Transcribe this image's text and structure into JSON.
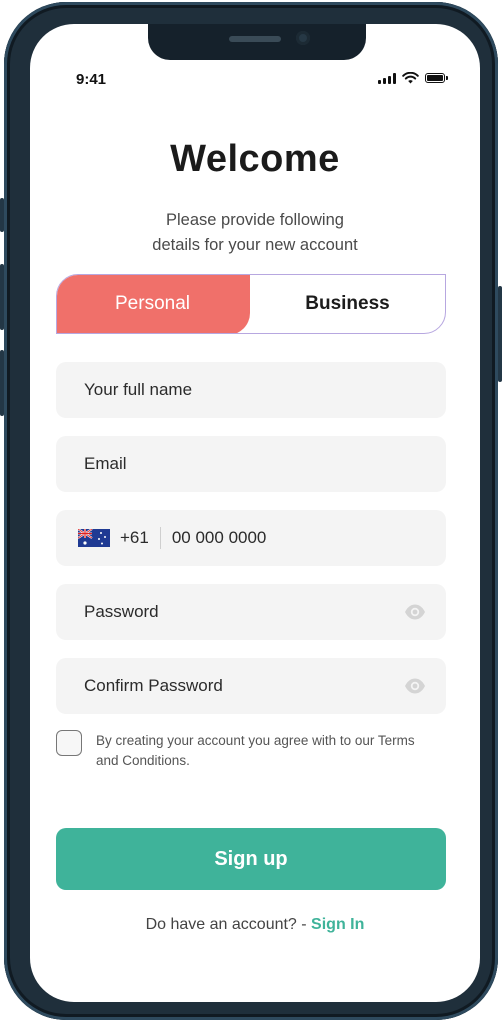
{
  "status_bar": {
    "time": "9:41"
  },
  "header": {
    "title": "Welcome",
    "subtitle_line1": "Please provide following",
    "subtitle_line2": "details for your new account"
  },
  "tabs": [
    {
      "label": "Personal",
      "active": true
    },
    {
      "label": "Business",
      "active": false
    }
  ],
  "form": {
    "full_name_placeholder": "Your full name",
    "email_placeholder": "Email",
    "phone": {
      "country": "Australia",
      "flag_icon": "australia-flag-icon",
      "code": "+61",
      "placeholder": "00 000 0000"
    },
    "password_placeholder": "Password",
    "confirm_password_placeholder": "Confirm Password",
    "terms_text": "By creating your account you agree with to our Terms and Conditions.",
    "terms_checked": false
  },
  "actions": {
    "signup_label": "Sign up",
    "signin_prompt": "Do have an account? - ",
    "signin_link": "Sign In"
  },
  "colors": {
    "accent_coral": "#f0706a",
    "primary_green": "#3fb39a",
    "tab_border": "#b7a7e0",
    "field_bg": "#f4f4f4"
  },
  "icons": {
    "show_password": "eye-icon",
    "signal": "cellular-signal-icon",
    "wifi": "wifi-icon",
    "battery": "battery-icon"
  }
}
